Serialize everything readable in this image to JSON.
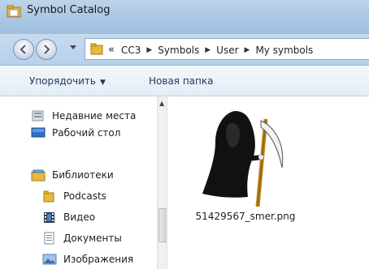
{
  "window": {
    "title": "Symbol Catalog"
  },
  "address_bar": {
    "overflow": "«",
    "crumbs": [
      "CC3",
      "Symbols",
      "User",
      "My symbols"
    ]
  },
  "toolbar": {
    "organize_label": "Упорядочить",
    "new_folder_label": "Новая папка"
  },
  "sidebar": {
    "items": [
      {
        "label": "Недавние места",
        "icon": "recent-places-icon"
      },
      {
        "label": "Рабочий стол",
        "icon": "desktop-icon"
      },
      {
        "label": "Библиотеки",
        "icon": "libraries-icon"
      },
      {
        "label": "Podcasts",
        "icon": "folder-icon"
      },
      {
        "label": "Видео",
        "icon": "video-icon"
      },
      {
        "label": "Документы",
        "icon": "documents-icon"
      },
      {
        "label": "Изображения",
        "icon": "pictures-icon"
      }
    ]
  },
  "files": [
    {
      "name": "51429567_smer.png",
      "icon": "grim-reaper-thumbnail"
    }
  ],
  "colors": {
    "titlebar": "#a9c6e4",
    "command_text": "#1e395b",
    "folder": "#e8b93c"
  }
}
